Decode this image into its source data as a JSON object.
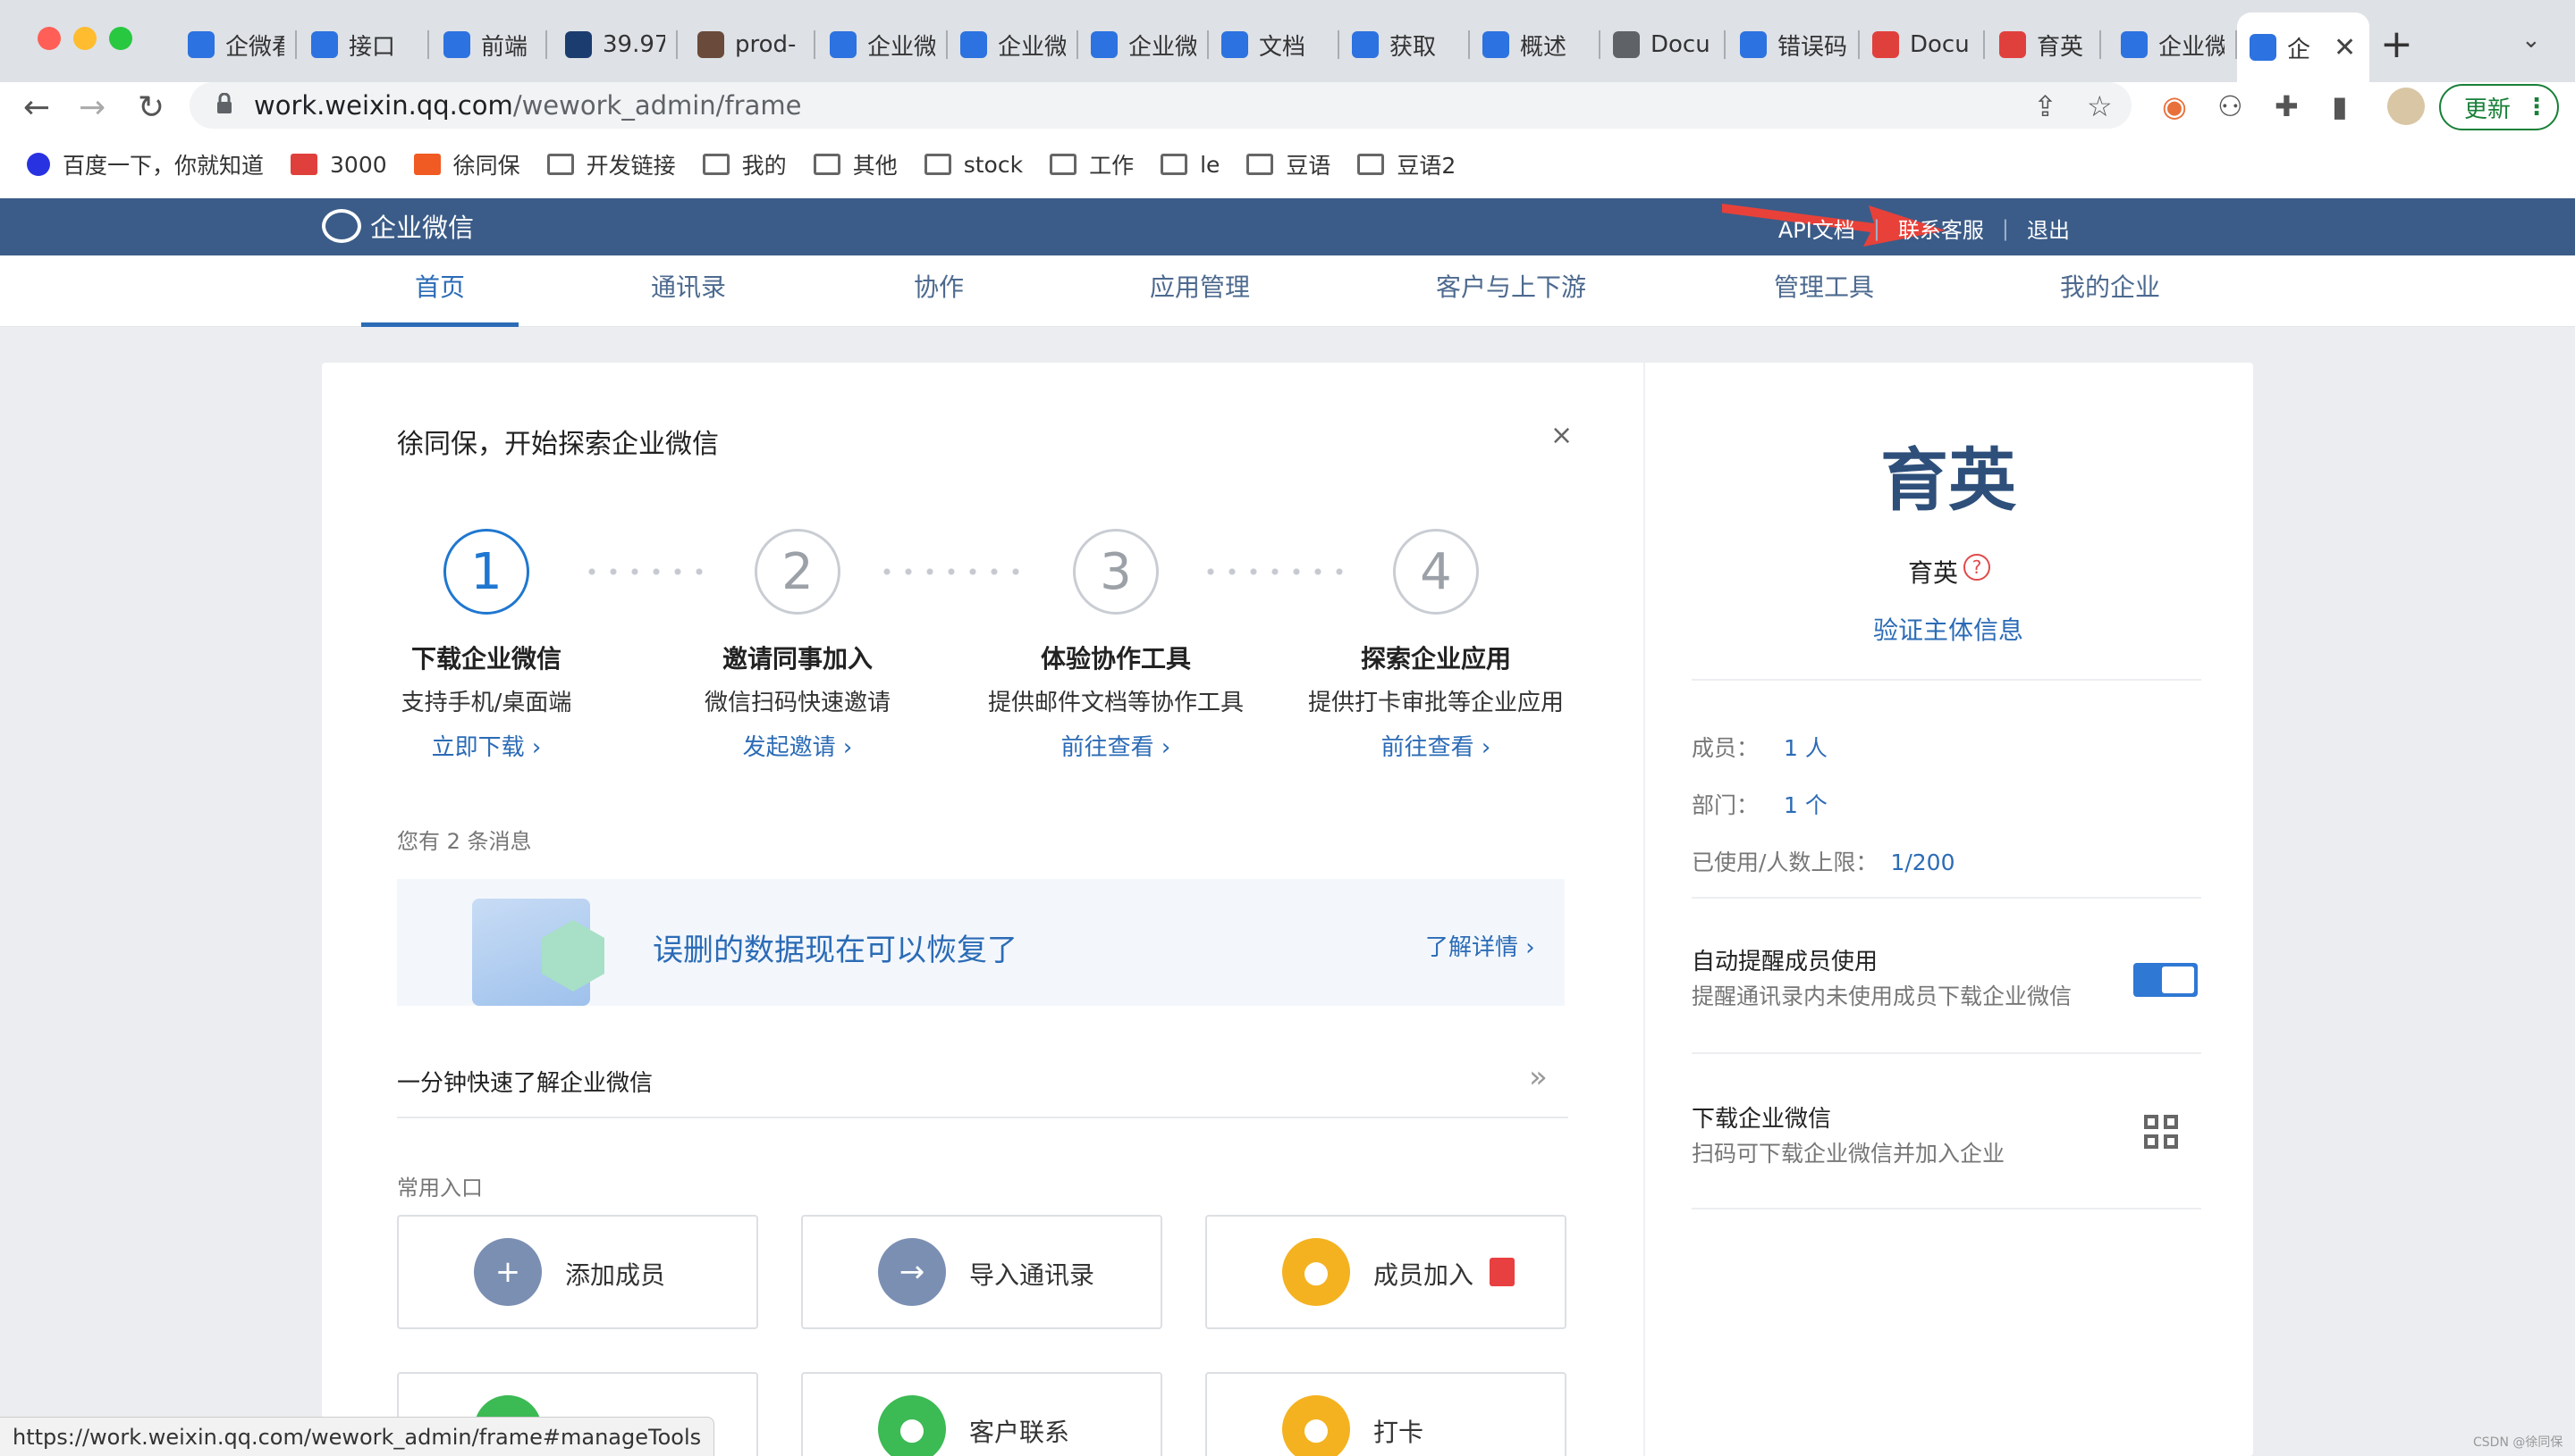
{
  "browser": {
    "tabs": [
      {
        "title": "企微看",
        "color": "#2c72e0"
      },
      {
        "title": "接口",
        "color": "#2c72e0"
      },
      {
        "title": "前端",
        "color": "#2c72e0"
      },
      {
        "title": "39.97",
        "color": "#1b3c6f"
      },
      {
        "title": "prod-",
        "color": "#6a4a3a"
      },
      {
        "title": "企业微",
        "color": "#2c72e0"
      },
      {
        "title": "企业微",
        "color": "#2c72e0"
      },
      {
        "title": "企业微",
        "color": "#2c72e0"
      },
      {
        "title": "文档",
        "color": "#2c72e0"
      },
      {
        "title": "获取",
        "color": "#2c72e0"
      },
      {
        "title": "概述",
        "color": "#2c72e0"
      },
      {
        "title": "Docu",
        "color": "#5f6368"
      },
      {
        "title": "错误码",
        "color": "#2c72e0"
      },
      {
        "title": "Docu",
        "color": "#e0403c"
      },
      {
        "title": "育英",
        "color": "#e0403c"
      },
      {
        "title": "企业微",
        "color": "#2c72e0"
      },
      {
        "title": "企",
        "color": "#2c72e0"
      }
    ],
    "url_host": "work.weixin.qq.com",
    "url_path": "/wework_admin/frame",
    "update_label": "更新",
    "bookmarks": [
      "百度一下，你就知道",
      "3000",
      "徐同保",
      "开发链接",
      "我的",
      "其他",
      "stock",
      "工作",
      "le",
      "豆语",
      "豆语2"
    ],
    "status_url": "https://work.weixin.qq.com/wework_admin/frame#manageTools"
  },
  "header": {
    "brand": "企业微信",
    "links": [
      "API文档",
      "联系客服",
      "退出"
    ]
  },
  "nav": [
    "首页",
    "通讯录",
    "协作",
    "应用管理",
    "客户与上下游",
    "管理工具",
    "我的企业"
  ],
  "welcome": {
    "title": "徐同保，开始探索企业微信",
    "close": "×",
    "steps": [
      {
        "num": "1",
        "title": "下载企业微信",
        "desc": "支持手机/桌面端",
        "link": "立即下载 ›"
      },
      {
        "num": "2",
        "title": "邀请同事加入",
        "desc": "微信扫码快速邀请",
        "link": "发起邀请 ›"
      },
      {
        "num": "3",
        "title": "体验协作工具",
        "desc": "提供邮件文档等协作工具",
        "link": "前往查看 ›"
      },
      {
        "num": "4",
        "title": "探索企业应用",
        "desc": "提供打卡审批等企业应用",
        "link": "前往查看 ›"
      }
    ]
  },
  "messages": {
    "count_text": "您有 2 条消息",
    "banner_text": "误删的数据现在可以恢复了",
    "banner_link": "了解详情 ›"
  },
  "intro": {
    "text": "一分钟快速了解企业微信",
    "more": "»"
  },
  "common": {
    "title": "常用入口",
    "entries": [
      {
        "label": "添加成员",
        "color": "#7b8fb3",
        "icon": "+"
      },
      {
        "label": "导入通讯录",
        "color": "#7b8fb3",
        "icon": "→"
      },
      {
        "label": "成员加入",
        "color": "#f4b221",
        "icon": "●"
      },
      {
        "label": "",
        "color": "#3cba54",
        "icon": "●"
      },
      {
        "label": "客户联系",
        "color": "#3cba54",
        "icon": "●"
      },
      {
        "label": "打卡",
        "color": "#f4b221",
        "icon": "●"
      }
    ]
  },
  "corp": {
    "big_name": "育英",
    "name": "育英",
    "question": "?",
    "verify": "验证主体信息",
    "stats": [
      {
        "label": "成员：",
        "value": "1 人"
      },
      {
        "label": "部门：",
        "value": "1 个"
      },
      {
        "label": "已使用/人数上限：",
        "value": "1/200"
      }
    ],
    "remind_title": "自动提醒成员使用",
    "remind_desc": "提醒通讯录内未使用成员下载企业微信",
    "remind_on": true,
    "download_title": "下载企业微信",
    "download_desc": "扫码可下载企业微信并加入企业"
  },
  "watermark": "CSDN @徐同保",
  "colors": {
    "header": "#3b5c88",
    "accent": "#2b6bb6",
    "arrow": "#e8413a"
  }
}
